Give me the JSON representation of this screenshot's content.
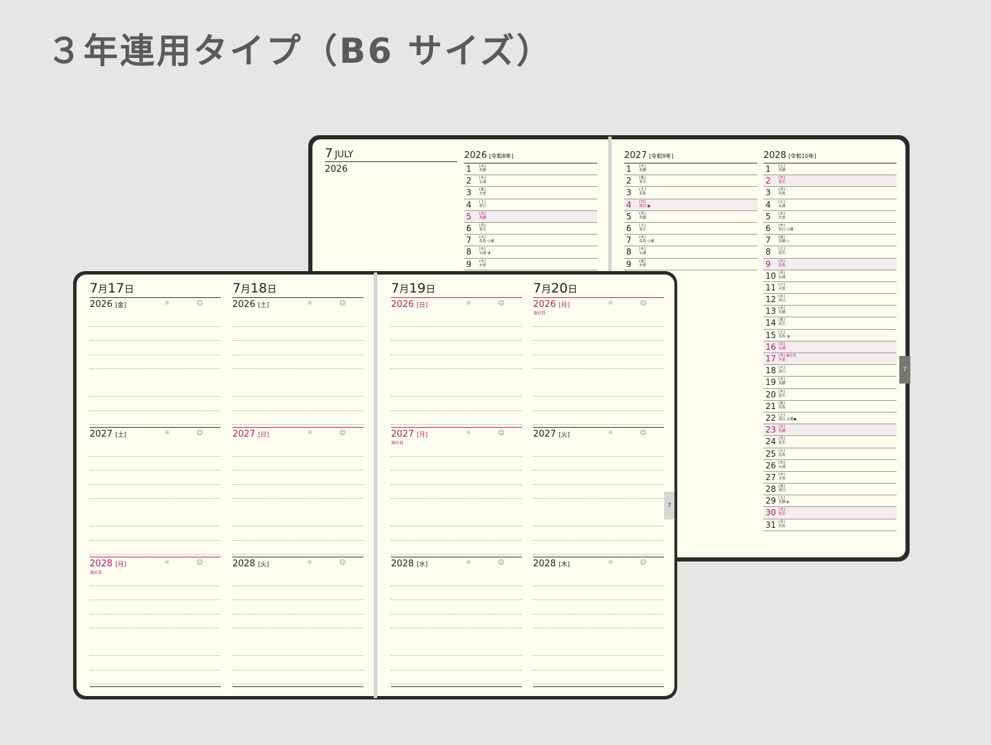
{
  "title": "３年連用タイプ（B6 サイズ）",
  "back_book": {
    "month_num": "7",
    "month_name": "JULY",
    "month_year": "2026",
    "years": [
      {
        "year": "2026",
        "era": "[令和8年]",
        "days": [
          {
            "d": "1",
            "l": "[水]\n先勝",
            "h": false
          },
          {
            "d": "2",
            "l": "[木]\n仏滅",
            "h": false
          },
          {
            "d": "3",
            "l": "[金]\n大安",
            "h": false
          },
          {
            "d": "4",
            "l": "[土]\n赤口",
            "h": false
          },
          {
            "d": "5",
            "l": "[日]\n先勝",
            "h": true
          },
          {
            "d": "6",
            "l": "[月]\n友引",
            "h": false
          },
          {
            "d": "7",
            "l": "[火]\n先負 小暑",
            "h": false
          },
          {
            "d": "8",
            "l": "[水]\n仏滅 ◑",
            "h": false
          },
          {
            "d": "9",
            "l": "[木]\n大安",
            "h": false
          }
        ]
      },
      {
        "year": "2027",
        "era": "[令和9年]",
        "days": [
          {
            "d": "1",
            "l": "[木]\n先勝",
            "h": false
          },
          {
            "d": "2",
            "l": "[金]\n友引",
            "h": false
          },
          {
            "d": "3",
            "l": "[土]\n先負",
            "h": false
          },
          {
            "d": "4",
            "l": "[日]\n赤口 ●",
            "h": true
          },
          {
            "d": "5",
            "l": "[月]\n先勝",
            "h": false
          },
          {
            "d": "6",
            "l": "[火]\n友引",
            "h": false
          },
          {
            "d": "7",
            "l": "[水]\n先負 小暑",
            "h": false
          },
          {
            "d": "8",
            "l": "[木]\n仏滅",
            "h": false
          },
          {
            "d": "9",
            "l": "[金]\n大安",
            "h": false
          }
        ]
      },
      {
        "year": "2028",
        "era": "[令和10年]",
        "days": [
          {
            "d": "1",
            "l": "[土]\n先勝",
            "h": false
          },
          {
            "d": "2",
            "l": "[日]\n友引",
            "h": true
          },
          {
            "d": "3",
            "l": "[月]\n先負",
            "h": false
          },
          {
            "d": "4",
            "l": "[火]\n仏滅",
            "h": false
          },
          {
            "d": "5",
            "l": "[水]\n大安",
            "h": false
          },
          {
            "d": "6",
            "l": "[木]\n赤口 小暑",
            "h": false
          },
          {
            "d": "7",
            "l": "[金]\n先勝 ○",
            "h": false
          },
          {
            "d": "8",
            "l": "[土]\n友引",
            "h": false
          },
          {
            "d": "9",
            "l": "[日]\n先負",
            "h": true
          },
          {
            "d": "10",
            "l": "[月]\n仏滅",
            "h": false
          },
          {
            "d": "11",
            "l": "[火]\n大安",
            "h": false
          },
          {
            "d": "12",
            "l": "[水]\n赤口",
            "h": false
          },
          {
            "d": "13",
            "l": "[木]\n先勝",
            "h": false
          },
          {
            "d": "14",
            "l": "[金]\n友引",
            "h": false
          },
          {
            "d": "15",
            "l": "[土]\n先負 ◑",
            "h": false
          },
          {
            "d": "16",
            "l": "[日]\n仏滅",
            "h": true
          },
          {
            "d": "17",
            "l": "[月] 海の日\n大安",
            "h": true
          },
          {
            "d": "18",
            "l": "[火]\n赤口",
            "h": false
          },
          {
            "d": "19",
            "l": "[水]\n先勝",
            "h": false
          },
          {
            "d": "20",
            "l": "[木]\n友引",
            "h": false
          },
          {
            "d": "21",
            "l": "[金]\n先負",
            "h": false
          },
          {
            "d": "22",
            "l": "[土]\n赤口 大暑●",
            "h": false
          },
          {
            "d": "23",
            "l": "[日]\n先勝",
            "h": true
          },
          {
            "d": "24",
            "l": "[月]\n友引",
            "h": false
          },
          {
            "d": "25",
            "l": "[火]\n先負",
            "h": false
          },
          {
            "d": "26",
            "l": "[水]\n仏滅",
            "h": false
          },
          {
            "d": "27",
            "l": "[木]\n大安",
            "h": false
          },
          {
            "d": "28",
            "l": "[金]\n赤口",
            "h": false
          },
          {
            "d": "29",
            "l": "[土]\n先勝 ◐",
            "h": false
          },
          {
            "d": "30",
            "l": "[日]\n友引",
            "h": true
          },
          {
            "d": "31",
            "l": "[月]\n先負",
            "h": false
          }
        ]
      }
    ],
    "tab": "7"
  },
  "front_book": {
    "tab": "7",
    "sun_icon": "☼",
    "smile_icon": "☺",
    "days": [
      {
        "m": "7",
        "mu": "月",
        "d": "17",
        "du": "日",
        "entries": [
          {
            "y": "2026",
            "w": "[金]",
            "red": false,
            "hn": ""
          },
          {
            "y": "2027",
            "w": "[土]",
            "red": false,
            "hn": ""
          },
          {
            "y": "2028",
            "w": "[月]",
            "red": true,
            "hn": "海の日"
          }
        ]
      },
      {
        "m": "7",
        "mu": "月",
        "d": "18",
        "du": "日",
        "entries": [
          {
            "y": "2026",
            "w": "[土]",
            "red": false,
            "hn": ""
          },
          {
            "y": "2027",
            "w": "[日]",
            "red": true,
            "hn": ""
          },
          {
            "y": "2028",
            "w": "[火]",
            "red": false,
            "hn": ""
          }
        ]
      },
      {
        "m": "7",
        "mu": "月",
        "d": "19",
        "du": "日",
        "entries": [
          {
            "y": "2026",
            "w": "[日]",
            "red": true,
            "hn": ""
          },
          {
            "y": "2027",
            "w": "[月]",
            "red": true,
            "hn": "海の日"
          },
          {
            "y": "2028",
            "w": "[水]",
            "red": false,
            "hn": ""
          }
        ]
      },
      {
        "m": "7",
        "mu": "月",
        "d": "20",
        "du": "日",
        "entries": [
          {
            "y": "2026",
            "w": "[月]",
            "red": true,
            "hn": "海の日"
          },
          {
            "y": "2027",
            "w": "[火]",
            "red": false,
            "hn": ""
          },
          {
            "y": "2028",
            "w": "[木]",
            "red": false,
            "hn": ""
          }
        ]
      }
    ]
  }
}
